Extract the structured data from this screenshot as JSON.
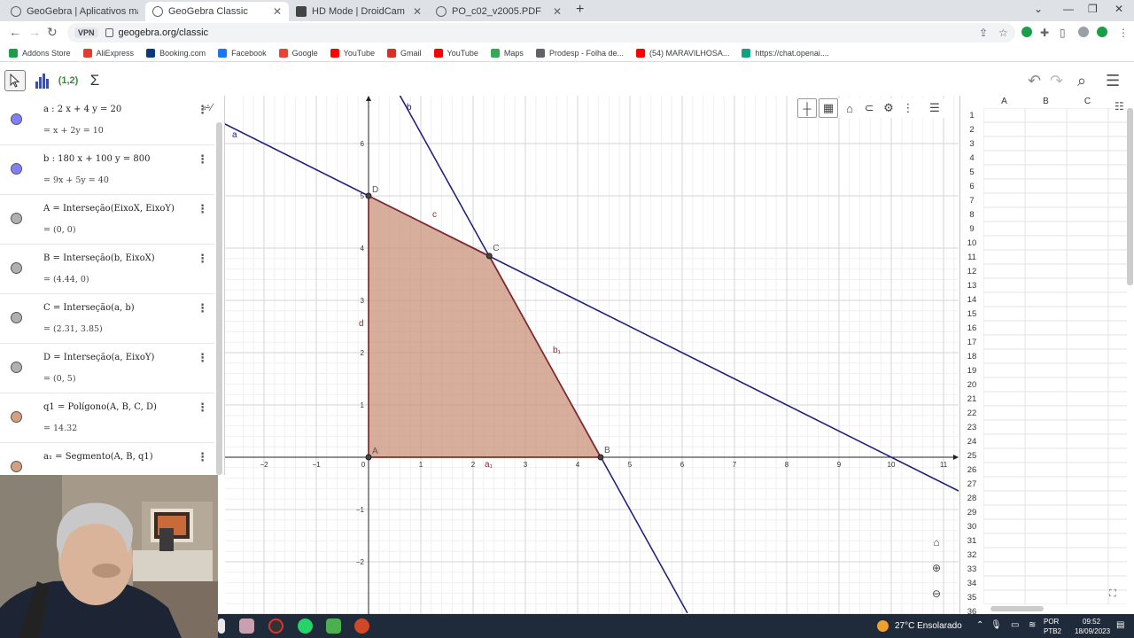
{
  "browser": {
    "tabs": [
      {
        "title": "GeoGebra | Aplicativos matemát",
        "active": false
      },
      {
        "title": "GeoGebra Classic",
        "active": true
      },
      {
        "title": "HD Mode | DroidCam",
        "active": false
      },
      {
        "title": "PO_c02_v2005.PDF",
        "active": false
      }
    ],
    "new_tab": "+",
    "url": "geogebra.org/classic",
    "vpn_label": "VPN",
    "bookmarks": [
      {
        "label": "Addons Store",
        "color": "#1a9e48"
      },
      {
        "label": "AliExpress",
        "color": "#e03d2f"
      },
      {
        "label": "Booking.com",
        "color": "#0b3a7a"
      },
      {
        "label": "Facebook",
        "color": "#1877f2"
      },
      {
        "label": "Google",
        "color": "#ea4335"
      },
      {
        "label": "YouTube",
        "color": "#ff0000"
      },
      {
        "label": "Gmail",
        "color": "#d93025"
      },
      {
        "label": "YouTube",
        "color": "#ff0000"
      },
      {
        "label": "Maps",
        "color": "#34a853"
      },
      {
        "label": "Prodesp - Folha de...",
        "color": "#5f6368"
      },
      {
        "label": "(54) MARAVILHOSA...",
        "color": "#ff0000"
      },
      {
        "label": "https://chat.openai....",
        "color": "#10a37f"
      }
    ]
  },
  "toolbar": {
    "tools": [
      "move-tool",
      "graph-tool",
      "point-tool",
      "sum-tool"
    ],
    "point_tool_label": "(1,2)",
    "sum_tool_label": "Σ"
  },
  "algebra": {
    "rows": [
      {
        "dot": "#8080ff",
        "def": "a : 2 x + 4 y  =  20",
        "val": "=  x + 2y  =  10"
      },
      {
        "dot": "#8080ff",
        "def": "b : 180 x + 100 y  =  800",
        "val": "=  9x + 5y  =  40"
      },
      {
        "dot": "#b0b0b0",
        "def": "A  =  Interseção(EixoX, EixoY)",
        "val": "=  (0, 0)"
      },
      {
        "dot": "#b0b0b0",
        "def": "B  =  Interseção(b, EixoX)",
        "val": "=  (4.44, 0)"
      },
      {
        "dot": "#b0b0b0",
        "def": "C  =  Interseção(a, b)",
        "val": "=  (2.31, 3.85)"
      },
      {
        "dot": "#b0b0b0",
        "def": "D  =  Interseção(a, EixoY)",
        "val": "=  (0, 5)"
      },
      {
        "dot": "#d4a080",
        "def": "q1  =  Polígono(A, B, C, D)",
        "val": "=  14.32"
      },
      {
        "dot": "#d4a080",
        "def": "a₁  =  Segmento(A, B, q1)",
        "val": ""
      }
    ]
  },
  "graphics": {
    "x_ticks": [
      "−2",
      "−1",
      "0",
      "1",
      "2",
      "3",
      "4",
      "5",
      "6",
      "7",
      "8",
      "9",
      "10",
      "11"
    ],
    "y_ticks": [
      "6",
      "5",
      "4",
      "3",
      "2",
      "1",
      "−1",
      "−2"
    ],
    "point_labels": {
      "A": "A",
      "B": "B",
      "C": "C",
      "D": "D"
    },
    "line_labels": {
      "a": "a",
      "b": "b",
      "c": "c",
      "d": "d",
      "b1": "b₁",
      "a1": "a₁"
    },
    "polygon_color": "#c9917a",
    "line_color": "#1a1a7a"
  },
  "spreadsheet": {
    "columns": [
      "A",
      "B",
      "C"
    ],
    "rows": [
      "1",
      "2",
      "3",
      "4",
      "5",
      "6",
      "7",
      "8",
      "9",
      "10",
      "11",
      "12",
      "13",
      "14",
      "15",
      "16",
      "17",
      "18",
      "19",
      "20",
      "21",
      "22",
      "23",
      "24",
      "25",
      "26",
      "27",
      "28",
      "29",
      "30",
      "31",
      "32",
      "33",
      "34",
      "35",
      "36"
    ]
  },
  "taskbar": {
    "weather": "27°C  Ensolarado",
    "lang": "POR",
    "lang_sub": "PTB2",
    "time": "09:52",
    "date": "18/09/2023"
  }
}
